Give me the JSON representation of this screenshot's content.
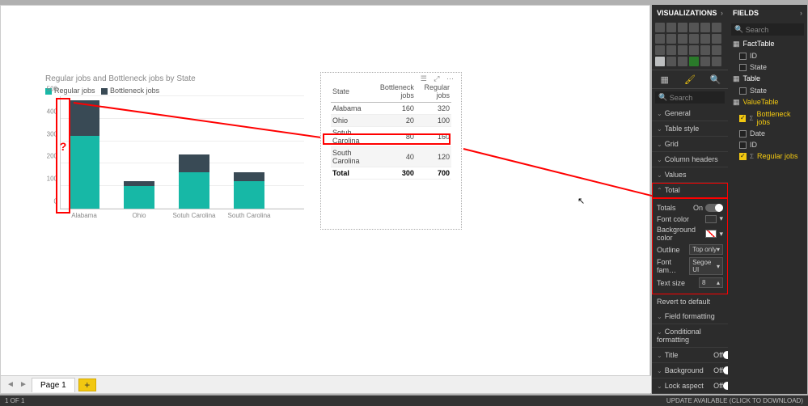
{
  "chart_data": {
    "type": "bar",
    "stacked": true,
    "title": "Regular jobs and Bottleneck jobs by State",
    "categories": [
      "Alabama",
      "Ohio",
      "Sotuh Carolina",
      "South Carolina"
    ],
    "series": [
      {
        "name": "Regular jobs",
        "values": [
          320,
          100,
          160,
          120
        ],
        "color": "#17b8a6"
      },
      {
        "name": "Bottleneck jobs",
        "values": [
          160,
          20,
          80,
          40
        ],
        "color": "#394a55"
      }
    ],
    "ylim": [
      0,
      500
    ],
    "ystep": 100,
    "ylabel": "",
    "xlabel": ""
  },
  "legend": {
    "regular": "Regular jobs",
    "bottleneck": "Bottleneck jobs"
  },
  "annot_question": "?",
  "table": {
    "headers": [
      "State",
      "Bottleneck jobs",
      "Regular jobs"
    ],
    "rows": [
      {
        "State": "Alabama",
        "Bottleneck jobs": 160,
        "Regular jobs": 320
      },
      {
        "State": "Ohio",
        "Bottleneck jobs": 20,
        "Regular jobs": 100
      },
      {
        "State": "Sotuh Carolina",
        "Bottleneck jobs": 80,
        "Regular jobs": 160
      },
      {
        "State": "South Carolina",
        "Bottleneck jobs": 40,
        "Regular jobs": 120
      }
    ],
    "total_label": "Total",
    "total": {
      "Bottleneck jobs": 300,
      "Regular jobs": 700
    }
  },
  "pages": {
    "page1": "Page 1",
    "add": "+"
  },
  "status": {
    "left": "1 OF 1",
    "right": "UPDATE AVAILABLE (CLICK TO DOWNLOAD)"
  },
  "viz": {
    "panel_title": "VISUALIZATIONS",
    "search": "Search",
    "sections": {
      "general": "General",
      "table_style": "Table style",
      "grid": "Grid",
      "column_headers": "Column headers",
      "values": "Values",
      "total": "Total",
      "field_formatting": "Field formatting",
      "conditional_formatting": "Conditional formatting",
      "title": "Title",
      "background": "Background",
      "lock_aspect": "Lock aspect"
    },
    "total_props": {
      "totals_label": "Totals",
      "totals_value": "On",
      "font_color_label": "Font color",
      "background_color_label": "Background color",
      "outline_label": "Outline",
      "outline_value": "Top only",
      "font_family_label": "Font fam…",
      "font_family_value": "Segoe UI",
      "text_size_label": "Text size",
      "text_size_value": "8"
    },
    "revert": "Revert to default",
    "off": "Off"
  },
  "fields": {
    "panel_title": "FIELDS",
    "search_placeholder": "Search",
    "tables": [
      {
        "name": "FactTable",
        "items": [
          {
            "label": "ID",
            "checked": false,
            "sigma": false
          },
          {
            "label": "State",
            "checked": false,
            "sigma": false
          }
        ]
      },
      {
        "name": "Table",
        "items": [
          {
            "label": "State",
            "checked": false,
            "sigma": false
          }
        ]
      },
      {
        "name": "ValueTable",
        "items": [
          {
            "label": "Bottleneck jobs",
            "checked": true,
            "sigma": true
          },
          {
            "label": "Date",
            "checked": false,
            "sigma": false
          },
          {
            "label": "ID",
            "checked": false,
            "sigma": false
          },
          {
            "label": "Regular jobs",
            "checked": true,
            "sigma": true
          }
        ]
      }
    ]
  }
}
